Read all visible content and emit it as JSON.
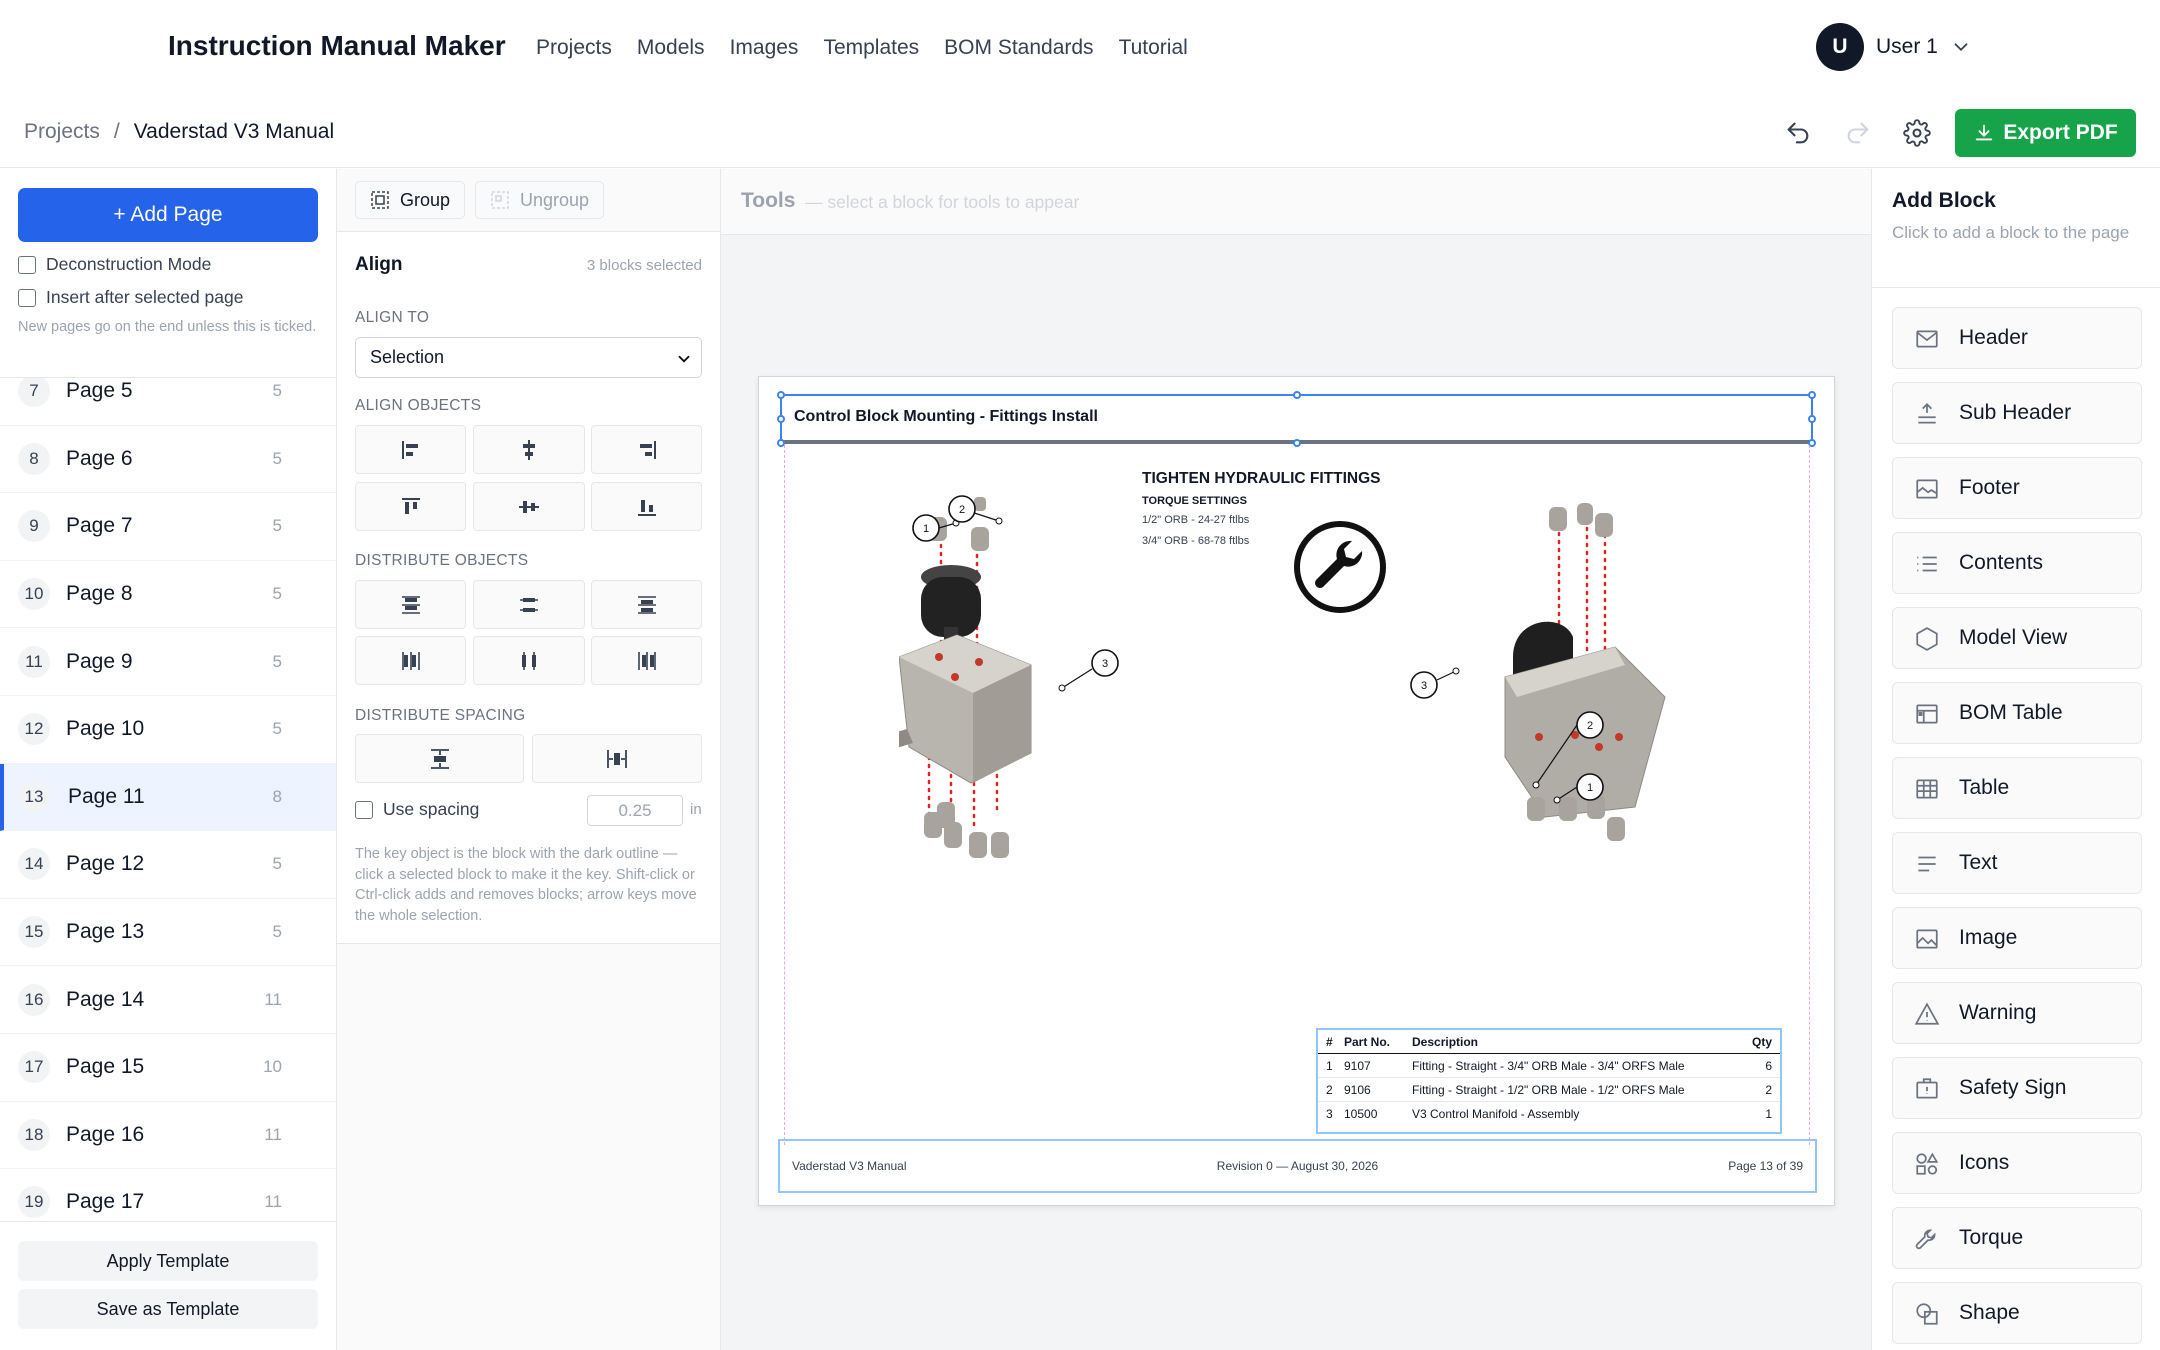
{
  "nav": {
    "brand": "Instruction Manual Maker",
    "links": [
      "Projects",
      "Models",
      "Images",
      "Templates",
      "BOM Standards",
      "Tutorial"
    ],
    "user_initial": "U",
    "user_name": "User 1"
  },
  "breadcrumb": {
    "root": "Projects",
    "sep": "/",
    "current": "Vaderstad V3 Manual"
  },
  "toolbar": {
    "export_label": "Export PDF"
  },
  "left": {
    "add_page": "+ Add Page",
    "deconstruction": "Deconstruction Mode",
    "insert_after": "Insert after selected page",
    "hint": "New pages go on the end unless this is ticked.",
    "pages": [
      {
        "n": "7",
        "t": "Page 5",
        "c": "5"
      },
      {
        "n": "8",
        "t": "Page 6",
        "c": "5"
      },
      {
        "n": "9",
        "t": "Page 7",
        "c": "5"
      },
      {
        "n": "10",
        "t": "Page 8",
        "c": "5"
      },
      {
        "n": "11",
        "t": "Page 9",
        "c": "5"
      },
      {
        "n": "12",
        "t": "Page 10",
        "c": "5"
      },
      {
        "n": "13",
        "t": "Page 11",
        "c": "8"
      },
      {
        "n": "14",
        "t": "Page 12",
        "c": "5"
      },
      {
        "n": "15",
        "t": "Page 13",
        "c": "5"
      },
      {
        "n": "16",
        "t": "Page 14",
        "c": "11"
      },
      {
        "n": "17",
        "t": "Page 15",
        "c": "10"
      },
      {
        "n": "18",
        "t": "Page 16",
        "c": "11"
      },
      {
        "n": "19",
        "t": "Page 17",
        "c": "11"
      }
    ],
    "apply_template": "Apply Template",
    "save_template": "Save as Template"
  },
  "align": {
    "group": "Group",
    "ungroup": "Ungroup",
    "title": "Align",
    "selected": "3 blocks selected",
    "align_to_label": "ALIGN TO",
    "align_to_value": "Selection",
    "align_objects": "ALIGN OBJECTS",
    "distribute_objects": "DISTRIBUTE OBJECTS",
    "distribute_spacing": "DISTRIBUTE SPACING",
    "use_spacing": "Use spacing",
    "spacing_value": "0.25",
    "spacing_unit": "in",
    "help": "The key object is the block with the dark outline — click a selected block to make it the key. Shift-click or Ctrl-click adds and removes blocks; arrow keys move the whole selection."
  },
  "tools": {
    "title": "Tools",
    "hint": "— select a block for tools to appear"
  },
  "doc": {
    "header": "Control Block Mounting - Fittings Install",
    "heading": "TIGHTEN HYDRAULIC FITTINGS",
    "torque_title": "TORQUE SETTINGS",
    "torque1": "1/2\" ORB - 24-27 ftlbs",
    "torque2": "3/4\" ORB - 68-78 ftlbs",
    "bom_headers": [
      "#",
      "Part No.",
      "Description",
      "Qty"
    ],
    "bom_rows": [
      [
        "1",
        "9107",
        "Fitting - Straight - 3/4\" ORB Male - 3/4\" ORFS Male",
        "6"
      ],
      [
        "2",
        "9106",
        "Fitting - Straight - 1/2\" ORB Male - 1/2\" ORFS Male",
        "2"
      ],
      [
        "3",
        "10500",
        "V3 Control Manifold - Assembly",
        "1"
      ]
    ],
    "footer_left": "Vaderstad V3 Manual",
    "footer_mid": "Revision 0 — August 30, 2026",
    "footer_right": "Page 13 of 39",
    "callouts": [
      "1",
      "2",
      "3"
    ]
  },
  "right": {
    "title": "Add Block",
    "sub": "Click to add a block to the page",
    "blocks": [
      {
        "label": "Header",
        "icon": "envelope-icon"
      },
      {
        "label": "Sub Header",
        "icon": "sub-header-icon"
      },
      {
        "label": "Footer",
        "icon": "footer-icon"
      },
      {
        "label": "Contents",
        "icon": "list-icon"
      },
      {
        "label": "Model View",
        "icon": "hexagon-icon"
      },
      {
        "label": "BOM Table",
        "icon": "bom-table-icon"
      },
      {
        "label": "Table",
        "icon": "table-icon"
      },
      {
        "label": "Text",
        "icon": "text-icon"
      },
      {
        "label": "Image",
        "icon": "image-icon"
      },
      {
        "label": "Warning",
        "icon": "warning-icon"
      },
      {
        "label": "Safety Sign",
        "icon": "safety-sign-icon"
      },
      {
        "label": "Icons",
        "icon": "shapes-icon"
      },
      {
        "label": "Torque",
        "icon": "wrench-icon"
      },
      {
        "label": "Shape",
        "icon": "shape-icon"
      }
    ]
  },
  "colors": {
    "accent": "#2563eb",
    "export": "#16a34a",
    "selection": "#3b82f6",
    "leader": "#dc2626"
  }
}
